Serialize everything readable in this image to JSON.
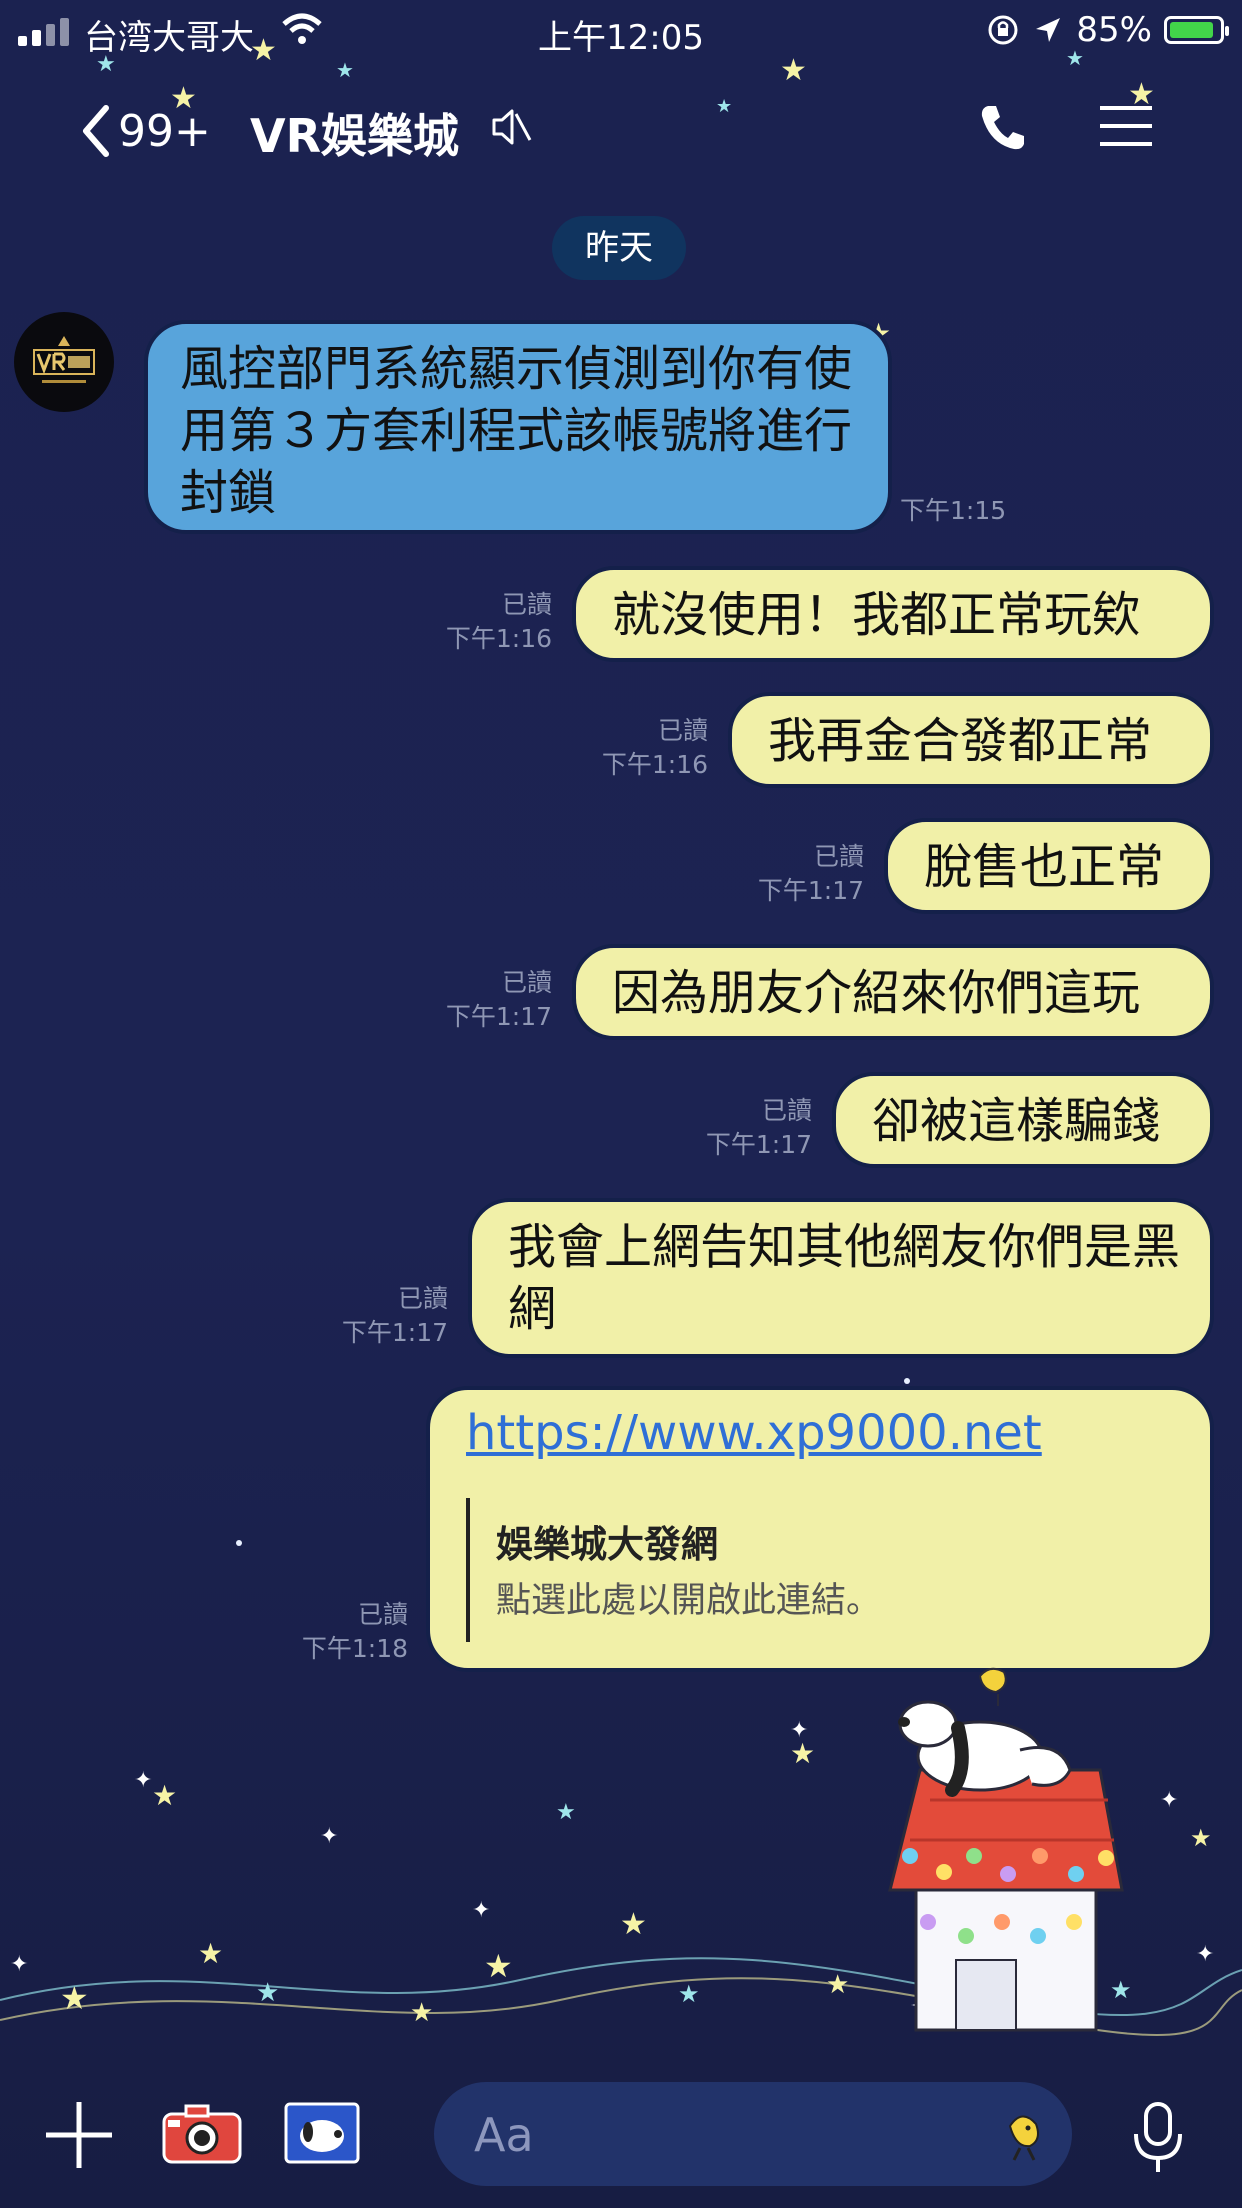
{
  "status_bar": {
    "carrier": "台湾大哥大",
    "time": "上午12:05",
    "battery": "85%",
    "battery_level": 0.85
  },
  "header": {
    "back_count": "99+",
    "title": "VR娛樂城"
  },
  "date_separator": "昨天",
  "messages": [
    {
      "text": "風控部門系統顯示偵測到你有使用第３方套利程式該帳號將進行封鎖",
      "time": "下午1:15"
    },
    {
      "text": "就沒使用！我都正常玩欸",
      "read": "已讀",
      "time": "下午1:16"
    },
    {
      "text": "我再金合發都正常",
      "read": "已讀",
      "time": "下午1:16"
    },
    {
      "text": "脫售也正常",
      "read": "已讀",
      "time": "下午1:17"
    },
    {
      "text": "因為朋友介紹來你們這玩",
      "read": "已讀",
      "time": "下午1:17"
    },
    {
      "text": "卻被這樣騙錢",
      "read": "已讀",
      "time": "下午1:17"
    },
    {
      "text": "我會上網告知其他網友你們是黑網",
      "read": "已讀",
      "time": "下午1:17"
    },
    {
      "url": "https://www.xp9000.net",
      "preview_title": "娛樂城大發網",
      "preview_desc": "點選此處以開啟此連結。",
      "read": "已讀",
      "time": "下午1:18"
    }
  ],
  "input": {
    "placeholder": "Aa"
  },
  "icons": [
    "back-icon",
    "mute-icon",
    "phone-icon",
    "menu-icon",
    "plus-icon",
    "camera-icon",
    "photo-icon",
    "emoji-icon",
    "mic-icon"
  ],
  "colors": {
    "outgoing_bubble": "#f1f0a8",
    "incoming_bubble": "#58a4db",
    "background": "#1c2352",
    "link": "#2f6fd6"
  }
}
